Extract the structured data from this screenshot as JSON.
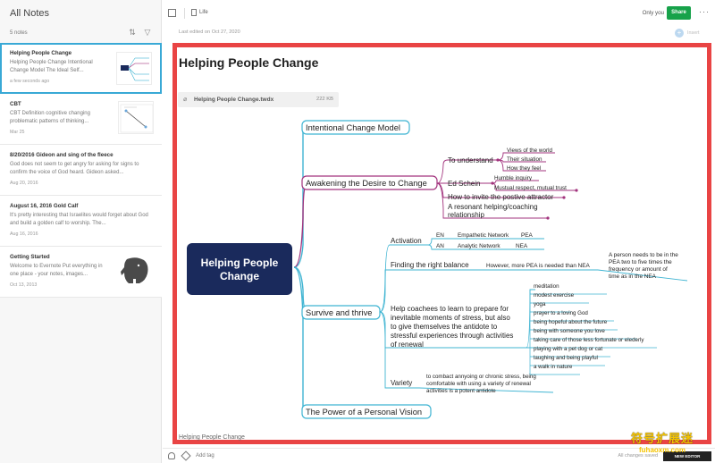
{
  "sidebar": {
    "title": "All Notes",
    "count": "5 notes",
    "notes": [
      {
        "title": "Helping People Change",
        "snippet": "Helping People Change Intentional Change Model The Ideal Self...",
        "date": "a few seconds ago"
      },
      {
        "title": "CBT",
        "snippet": "CBT Definition cognitive changing problematic patterns of thinking...",
        "date": "Mar 25"
      },
      {
        "title": "8/20/2016 Gideon and sing of the fleece",
        "snippet": "God does not seem to get angry for asking for signs to confirm the voice of God heard. Gideon asked...",
        "date": "Aug 20, 2016"
      },
      {
        "title": "August 16, 2016 Gold Calf",
        "snippet": "It's pretty interesting that Israelites would forget about God and build a golden calf to worship. The...",
        "date": "Aug 16, 2016"
      },
      {
        "title": "Getting Started",
        "snippet": "Welcome to Evernote Put everything in one place - your notes, images...",
        "date": "Oct 13, 2013"
      }
    ]
  },
  "header": {
    "notebook": "Life",
    "only_you": "Only you",
    "share": "Share",
    "more": "···",
    "last_edited": "Last edited on Oct 27, 2020",
    "insert": "Insert"
  },
  "note": {
    "title": "Helping People Change",
    "attachment_name": "Helping People Change.twdx",
    "attachment_size": "222 KB",
    "footer_text": "Helping People Change"
  },
  "mindmap": {
    "root": [
      "Helping People",
      "Change"
    ],
    "branches": {
      "intentional": "Intentional Change Model",
      "awakening": "Awakening the Desire to Change",
      "survive": "Survive and thrive",
      "vision": "The Power of a Personal Vision"
    },
    "awakening_children": {
      "understand": "To understand",
      "understand_items": [
        "Views of the world",
        "Their situation",
        "How they feel"
      ],
      "schein": "Ed Schein",
      "schein_items": [
        "Humble inquiry",
        "Mustual respect, mutual trust"
      ],
      "invite": "How to invite the postive attractor",
      "resonant": [
        "A resonant helping/coaching",
        "relationship"
      ]
    },
    "survive_children": {
      "activation": "Activation",
      "activation_rows": [
        [
          "EN",
          "Empathetic Network",
          "PEA"
        ],
        [
          "AN",
          "Analytic Network",
          "NEA"
        ]
      ],
      "finding": "Finding the right balance",
      "finding_note": "However, more PEA is needed than NEA",
      "finding_detail": [
        "A person needs to be in the",
        "PEA two to five times the",
        "frequency or amount of",
        "time as in the NEA"
      ],
      "help": [
        "Help coachees to learn to prepare for",
        "inevitable moments of stress, but also",
        "to give themselves the antidote to",
        "stressful experiences through activities",
        "of renewal"
      ],
      "renewal": [
        "meditation",
        "modest exercise",
        "yoga",
        "prayer to a loving God",
        "being hopeful about the future",
        "being with someone you love",
        "taking care of those less fortunate or elederly",
        "playing with a pet dog or cat",
        "laughing and being playful",
        "a walk in nature"
      ],
      "variety": "Variety",
      "variety_note": [
        "to combact annyoing or chronic stress, being",
        "comfortable with using a variety of renewal",
        "activities is a potent antidote"
      ]
    },
    "colors": {
      "root_fill": "#1a2a5c",
      "blue": "#3fb4d2",
      "magenta": "#a2337d"
    }
  },
  "bottom": {
    "add_tag": "Add tag",
    "saved": "All changes saved",
    "new_editor": "NEW EDITOR"
  },
  "watermark": {
    "cn": "符号扩展迷",
    "url": "fuhaoxm.com"
  }
}
